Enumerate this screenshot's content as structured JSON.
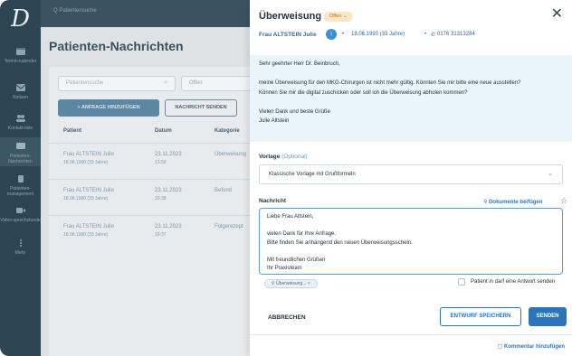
{
  "nav": {
    "logo": "D",
    "items": [
      {
        "label": "Termin-kalender",
        "icon": "calendar-icon"
      },
      {
        "label": "Notizen",
        "icon": "mail-icon"
      },
      {
        "label": "Kontakt-liste",
        "icon": "contacts-icon"
      },
      {
        "label": "Patienten-Nachrichten",
        "icon": "message-icon"
      },
      {
        "label": "Patienten-management",
        "icon": "patient-icon"
      },
      {
        "label": "Video-sprechstunde",
        "icon": "video-icon"
      },
      {
        "label": "Mehr",
        "icon": "more-icon"
      }
    ]
  },
  "topbar": {
    "search_placeholder": "Q  Patientensuche"
  },
  "background": {
    "title": "Patienten-Nachrichten",
    "search_placeholder": "Patientensuche",
    "filter_value": "Offen",
    "add_template_button": "+ ANFRAGE HINZUFÜGEN",
    "send_message_button": "NACHRICHT SENDEN",
    "columns": [
      "Patient",
      "Datum",
      "Kategorie"
    ],
    "rows": [
      {
        "name": "Frau ALTSTEIN Julie",
        "dob": "18.06.1990 (33 Jahre)",
        "date": "23.11.2023",
        "time": "13:59",
        "category": "Überweisung"
      },
      {
        "name": "Frau ALTSTEIN Julie",
        "dob": "18.06.1990 (33 Jahre)",
        "date": "23.11.2023",
        "time": "10:38",
        "category": "Befund"
      },
      {
        "name": "Frau ALTSTEIN Julie",
        "dob": "18.06.1990 (33 Jahre)",
        "date": "23.11.2023",
        "time": "10:37",
        "category": "Folgerezept"
      }
    ]
  },
  "panel": {
    "title": "Überweisung",
    "status_badge": "Offen",
    "patient_name": "Frau ALTSTEIN Julie",
    "dob": "18.06.1990 (33 Jahre)",
    "phone": "0176 31313284",
    "message_lines": [
      "Sehr geehrter Herr Dr. Beinbruch,",
      "",
      "meine Überweisung für den MKG-Chirurgen ist nicht mehr gültig. Könnten Sie mir bitte eine neue ausstellen?",
      "Können Sie mir die digital zuschicken oder soll ich die Überweisung abholen kommen?",
      "",
      "Vielen Dank und beste Grüße",
      "Julie Altstein"
    ],
    "template_label": "Vorlage",
    "template_optional": "(Optional)",
    "template_value": "Klassische Vorlage mit Grußformeln",
    "message_label": "Nachricht",
    "attach_docs": "Dokumente beifügen",
    "reply_lines": [
      "Liebe Frau Altstein,",
      "",
      "vielen Dank für Ihre Anfrage.",
      "Bitte finden Sie anhängend den neuen Überweisungsschein.",
      "",
      "Mit freundlichen Grüßen",
      "Ihr Praxisteam"
    ],
    "attachment_chip": "Überweisung...",
    "allow_reply_label": "Patient in darf eine Antwort senden",
    "cancel_button": "ABBRECHEN",
    "draft_button": "ENTWURF SPEICHERN",
    "send_button": "SENDEN",
    "add_comment": "Kommentar hinzufügen"
  }
}
